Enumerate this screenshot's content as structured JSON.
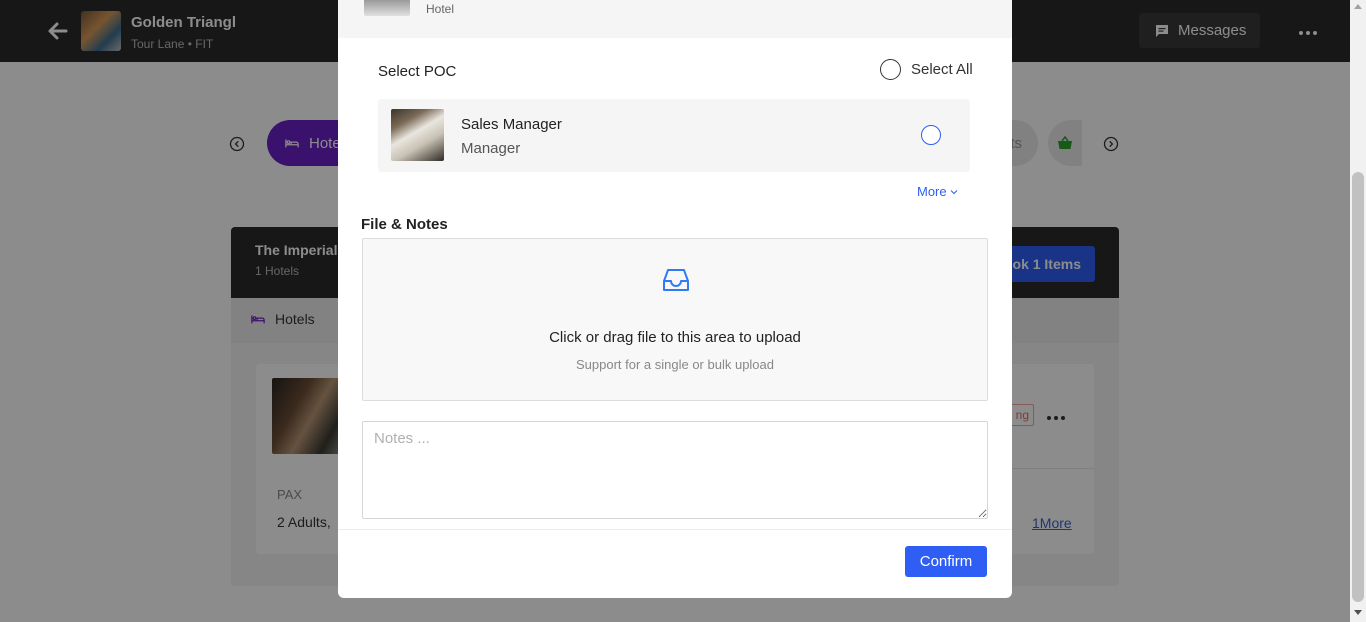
{
  "topbar": {
    "tour_title": "Golden Triangl",
    "tour_subtitle": "Tour Lane • FIT",
    "messages_label": "Messages"
  },
  "categories": {
    "active_label": "Hote",
    "right_partial_label": "ts"
  },
  "panel": {
    "title": "The Imperial,",
    "subtitle": "1 Hotels",
    "book_label": "ok 1 Items",
    "tab_label": "Hotels",
    "card": {
      "badge_partial": "ng",
      "pax_label": "PAX",
      "pax_value": "2 Adults,",
      "more_link": "1More"
    }
  },
  "modal": {
    "header_label": "Hotel",
    "select_poc_title": "Select POC",
    "select_all_label": "Select All",
    "poc": {
      "name": "Sales Manager",
      "role": "Manager"
    },
    "more_label": "More",
    "file_notes_title": "File & Notes",
    "upload_title": "Click or drag file to this area to upload",
    "upload_subtitle": "Support for a single or bulk upload",
    "notes_placeholder": "Notes ...",
    "confirm_label": "Confirm"
  },
  "colors": {
    "accent": "#2f5ef5",
    "category_active": "#6a1fc7",
    "topbar": "#2b2b2b"
  },
  "icons": {
    "back": "arrow-left-icon",
    "messages": "chat-bubble-icon",
    "more": "ellipsis-icon",
    "upload": "inbox-icon",
    "basket": "basket-icon",
    "bed": "bed-icon"
  }
}
